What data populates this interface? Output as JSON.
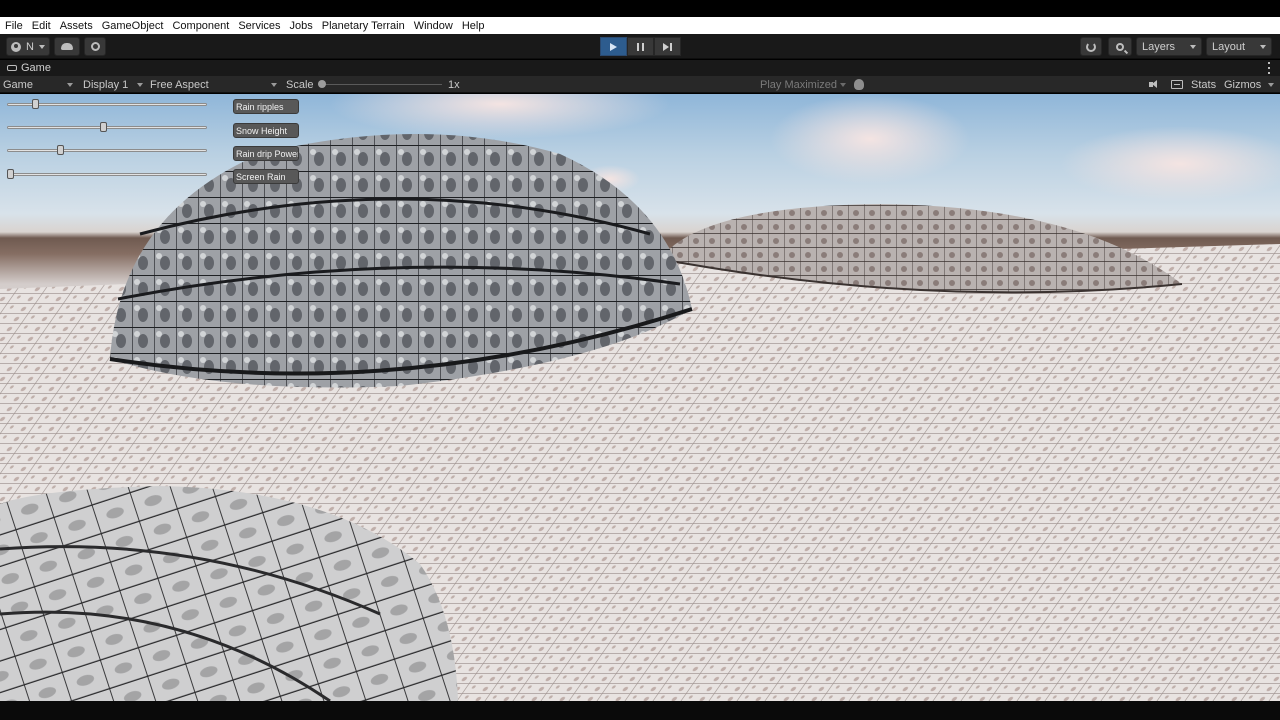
{
  "menu": [
    "File",
    "Edit",
    "Assets",
    "GameObject",
    "Component",
    "Services",
    "Jobs",
    "Planetary Terrain",
    "Window",
    "Help"
  ],
  "toolbar": {
    "account_initial": "N",
    "layers_label": "Layers",
    "layout_label": "Layout",
    "icons": [
      "account-icon",
      "cloud-icon",
      "gear-icon",
      "play-icon",
      "pause-icon",
      "step-icon",
      "history-icon",
      "search-icon"
    ],
    "accent": "#2d5c8e"
  },
  "tab": {
    "title": "Game"
  },
  "game_toolbar": {
    "view": "Game",
    "display": "Display 1",
    "aspect": "Free Aspect",
    "scale_label": "Scale",
    "scale_value": "1x",
    "play_maximized": "Play Maximized",
    "stats": "Stats",
    "gizmos": "Gizmos"
  },
  "hud": {
    "sliders": [
      {
        "name": "rain-ripples",
        "value": 0.13
      },
      {
        "name": "snow-height",
        "value": 0.48
      },
      {
        "name": "rain-drip-power",
        "value": 0.26
      },
      {
        "name": "screen-rain",
        "value": 0.0
      }
    ],
    "buttons": [
      "Rain ripples",
      "Snow Height",
      "Rain drip Power",
      "Screen Rain"
    ]
  }
}
